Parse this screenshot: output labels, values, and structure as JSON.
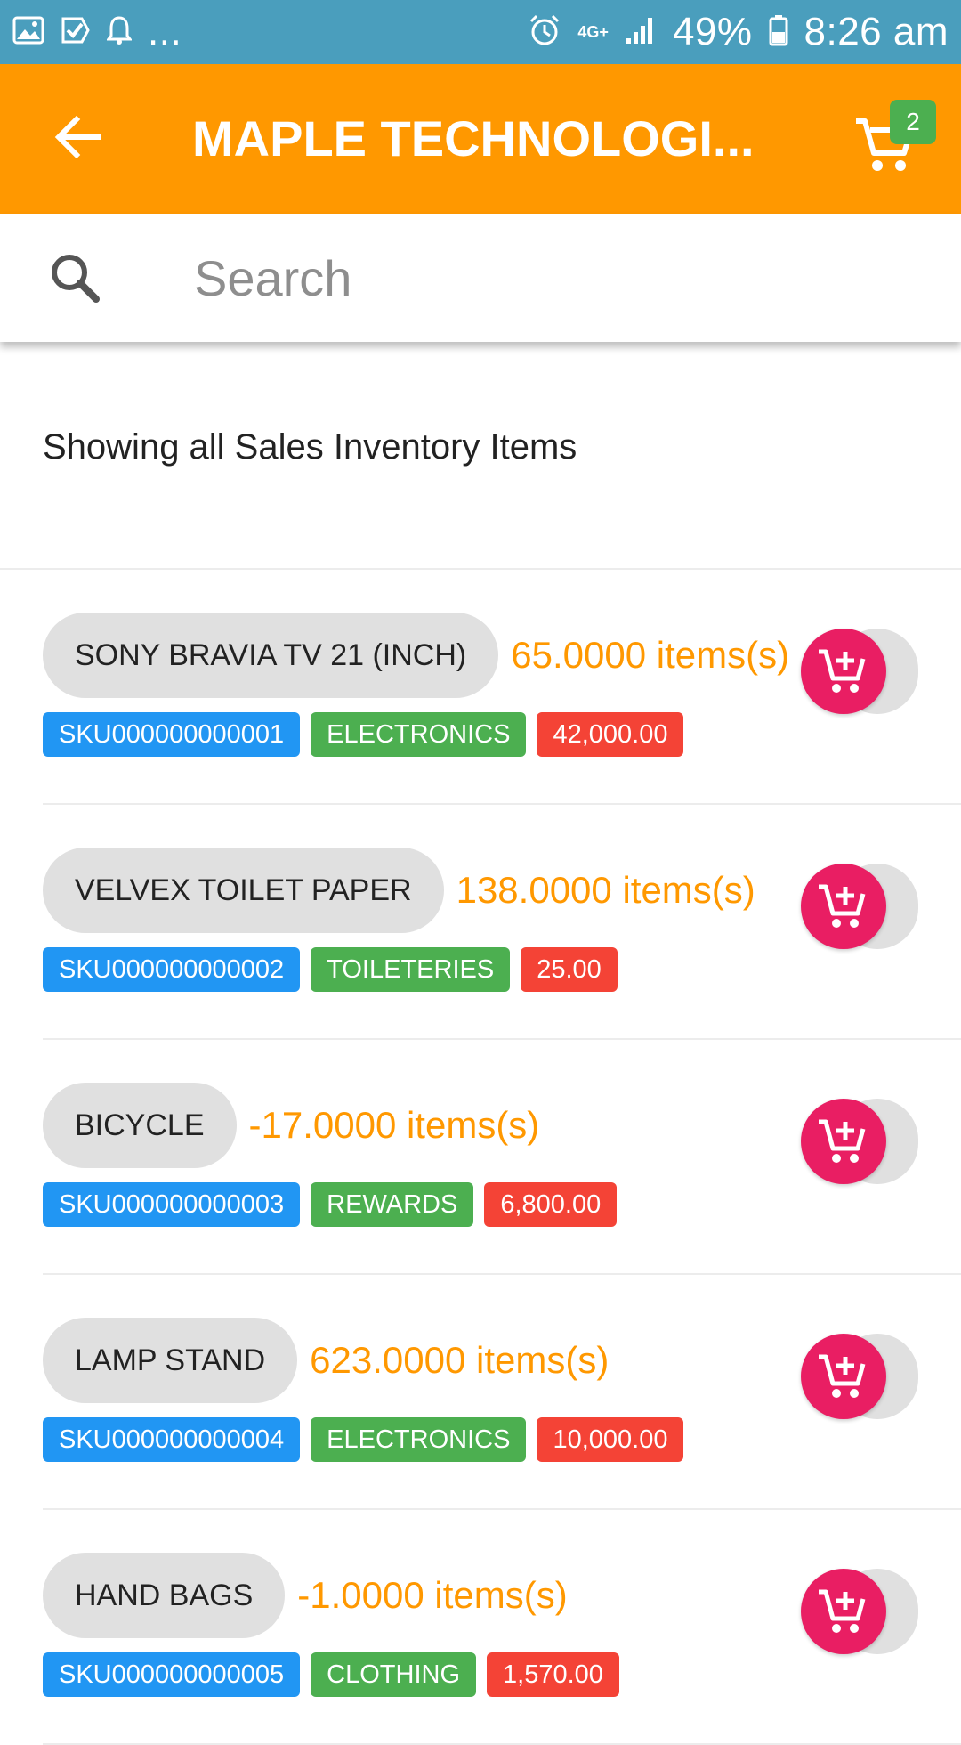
{
  "status_bar": {
    "left_icons": [
      "image-icon",
      "check-icon",
      "bell-icon"
    ],
    "overflow": "...",
    "network": "4G+",
    "battery": "49%",
    "time": "8:26 am"
  },
  "app_bar": {
    "title": "MAPLE TECHNOLOGI...",
    "cart_count": "2",
    "color": "#ff9800"
  },
  "search": {
    "placeholder": "Search"
  },
  "subtitle": "Showing all Sales Inventory Items",
  "items": [
    {
      "name": "SONY BRAVIA TV 21 (INCH)",
      "qty": "65.0000 items(s)",
      "sku": "SKU000000000001",
      "category": "ELECTRONICS",
      "price": "42,000.00"
    },
    {
      "name": "VELVEX TOILET PAPER",
      "qty": "138.0000 items(s)",
      "sku": "SKU000000000002",
      "category": "TOILETERIES",
      "price": "25.00"
    },
    {
      "name": "BICYCLE",
      "qty": "-17.0000 items(s)",
      "sku": "SKU000000000003",
      "category": "REWARDS",
      "price": "6,800.00"
    },
    {
      "name": "LAMP STAND",
      "qty": "623.0000 items(s)",
      "sku": "SKU000000000004",
      "category": "ELECTRONICS",
      "price": "10,000.00"
    },
    {
      "name": "HAND BAGS",
      "qty": "-1.0000 items(s)",
      "sku": "SKU000000000005",
      "category": "CLOTHING",
      "price": "1,570.00"
    }
  ],
  "colors": {
    "sku_tag": "#2196f3",
    "category_tag": "#4caf50",
    "price_tag": "#f44336",
    "add_to_cart": "#e91e63"
  }
}
